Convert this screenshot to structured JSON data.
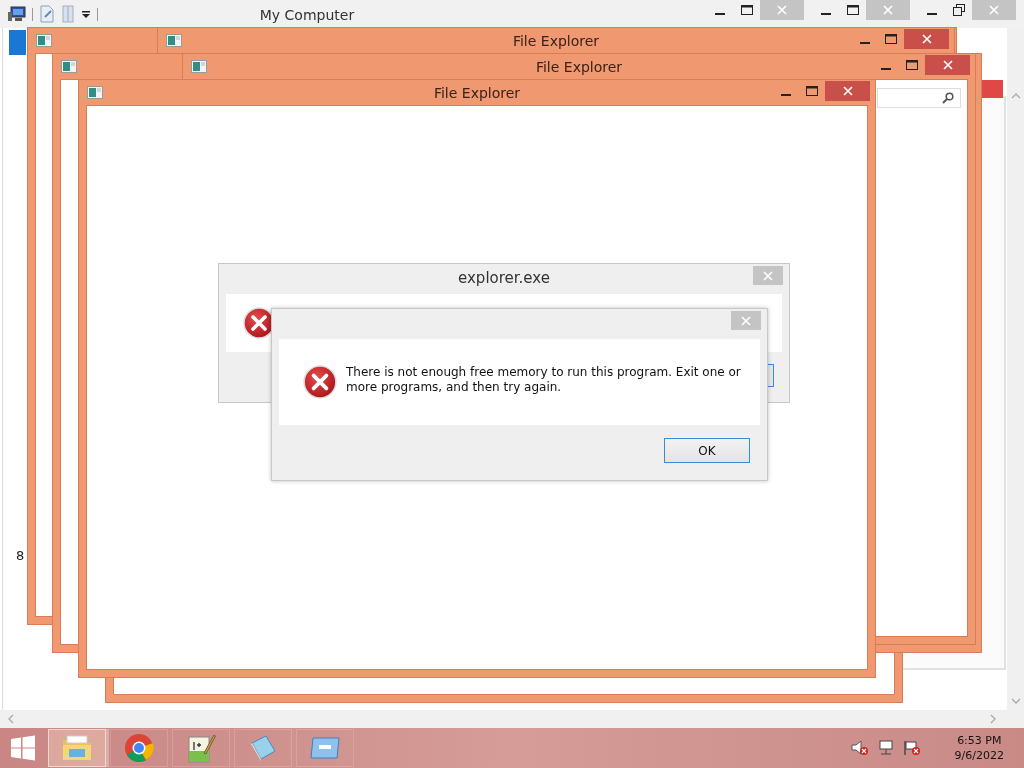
{
  "desktop_window": {
    "title": "My Computer",
    "stray_text": "8"
  },
  "explorer_windows": [
    {
      "kind": "frame_only"
    },
    {
      "kind": "untitled"
    },
    {
      "kind": "titled",
      "title": "File Explorer"
    },
    {
      "kind": "untitled"
    },
    {
      "kind": "titled",
      "title": "File Explorer",
      "search_box": true
    },
    {
      "kind": "titled",
      "title": "File Explorer"
    }
  ],
  "dialogs": [
    {
      "kind": "back",
      "title": "explorer.exe"
    },
    {
      "kind": "front",
      "message": "There is not enough free memory to run this program. Exit one or more programs, and then try again.",
      "button": "OK"
    }
  ],
  "taskbar": {
    "apps": [
      {
        "kind": "explorer",
        "selected": true
      },
      {
        "kind": "browser",
        "selected": false
      },
      {
        "kind": "editor",
        "selected": false
      },
      {
        "kind": "notepad",
        "selected": false
      },
      {
        "kind": "window",
        "selected": false
      }
    ],
    "clock": {
      "time": "6:53 PM",
      "date": "9/6/2022"
    }
  }
}
